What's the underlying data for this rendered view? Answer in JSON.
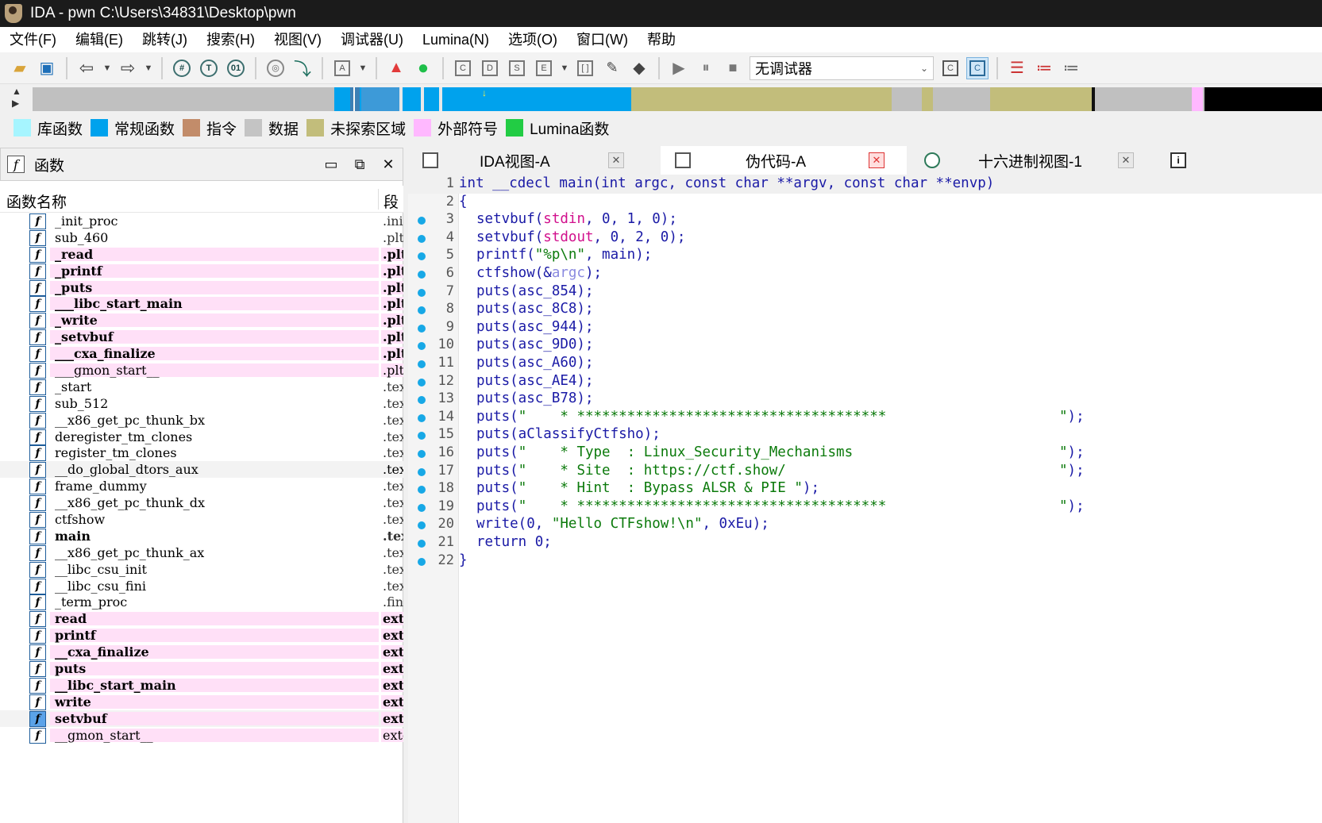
{
  "window": {
    "title": "IDA - pwn C:\\Users\\34831\\Desktop\\pwn"
  },
  "menu": [
    "文件(F)",
    "编辑(E)",
    "跳转(J)",
    "搜索(H)",
    "视图(V)",
    "调试器(U)",
    "Lumina(N)",
    "选项(O)",
    "窗口(W)",
    "帮助"
  ],
  "toolbar": {
    "debugger_select": "无调试器"
  },
  "legend": [
    {
      "label": "库函数",
      "color": "#a6f5ff"
    },
    {
      "label": "常规函数",
      "color": "#00a2ed"
    },
    {
      "label": "指令",
      "color": "#c28c6a"
    },
    {
      "label": "数据",
      "color": "#c4c4c4"
    },
    {
      "label": "未探索区域",
      "color": "#c2bd7b"
    },
    {
      "label": "外部符号",
      "color": "#ffb8ff"
    },
    {
      "label": "Lumina函数",
      "color": "#22cc44"
    }
  ],
  "functions_panel": {
    "title": "函数",
    "col_name": "函数名称",
    "col_segment": "段",
    "items": [
      {
        "name": "_init_proc",
        "segment": ".init",
        "style": "normal"
      },
      {
        "name": "sub_460",
        "segment": ".plt",
        "style": "normal"
      },
      {
        "name": "_read",
        "segment": ".plt",
        "style": "lib"
      },
      {
        "name": "_printf",
        "segment": ".plt",
        "style": "lib"
      },
      {
        "name": "_puts",
        "segment": ".plt",
        "style": "lib"
      },
      {
        "name": "___libc_start_main",
        "segment": ".plt",
        "style": "lib"
      },
      {
        "name": "_write",
        "segment": ".plt",
        "style": "lib"
      },
      {
        "name": "_setvbuf",
        "segment": ".plt",
        "style": "lib"
      },
      {
        "name": "___cxa_finalize",
        "segment": ".plt",
        "style": "lib"
      },
      {
        "name": "___gmon_start__",
        "segment": ".plt",
        "style": "libthin"
      },
      {
        "name": "_start",
        "segment": ".text",
        "style": "normal"
      },
      {
        "name": "sub_512",
        "segment": ".text",
        "style": "normal"
      },
      {
        "name": "__x86_get_pc_thunk_bx",
        "segment": ".text",
        "style": "normal"
      },
      {
        "name": "deregister_tm_clones",
        "segment": ".text",
        "style": "normal"
      },
      {
        "name": "register_tm_clones",
        "segment": ".text",
        "style": "normal"
      },
      {
        "name": "__do_global_dtors_aux",
        "segment": ".text",
        "style": "hl"
      },
      {
        "name": "frame_dummy",
        "segment": ".text",
        "style": "normal"
      },
      {
        "name": "__x86_get_pc_thunk_dx",
        "segment": ".text",
        "style": "normal"
      },
      {
        "name": "ctfshow",
        "segment": ".text",
        "style": "normal"
      },
      {
        "name": "main",
        "segment": ".text",
        "style": "bold"
      },
      {
        "name": "__x86_get_pc_thunk_ax",
        "segment": ".text",
        "style": "normal"
      },
      {
        "name": "__libc_csu_init",
        "segment": ".text",
        "style": "normal"
      },
      {
        "name": "__libc_csu_fini",
        "segment": ".text",
        "style": "normal"
      },
      {
        "name": "_term_proc",
        "segment": ".fini",
        "style": "normal"
      },
      {
        "name": "read",
        "segment": "extern",
        "style": "lib"
      },
      {
        "name": "printf",
        "segment": "extern",
        "style": "lib"
      },
      {
        "name": "__cxa_finalize",
        "segment": "extern",
        "style": "lib"
      },
      {
        "name": "puts",
        "segment": "extern",
        "style": "lib"
      },
      {
        "name": "__libc_start_main",
        "segment": "extern",
        "style": "lib"
      },
      {
        "name": "write",
        "segment": "extern",
        "style": "lib"
      },
      {
        "name": "setvbuf",
        "segment": "extern",
        "style": "libsel"
      },
      {
        "name": "__gmon_start__",
        "segment": "extern",
        "style": "libthin"
      }
    ]
  },
  "tabs": [
    {
      "label": "IDA视图-A",
      "active": false
    },
    {
      "label": "伪代码-A",
      "active": true
    },
    {
      "label": "十六进制视图-1",
      "active": false
    }
  ],
  "pseudocode": [
    {
      "n": "1",
      "dot": false,
      "parts": [
        [
          "sig",
          "int __cdecl main(int argc, const char **argv, const char **envp)"
        ]
      ]
    },
    {
      "n": "2",
      "dot": false,
      "parts": [
        [
          "kw",
          "{"
        ]
      ]
    },
    {
      "n": "3",
      "dot": true,
      "ind": true,
      "parts": [
        [
          "kw",
          "setvbuf("
        ],
        [
          "glob",
          "stdin"
        ],
        [
          "kw",
          ", 0, 1, 0);"
        ]
      ]
    },
    {
      "n": "4",
      "dot": true,
      "ind": true,
      "parts": [
        [
          "kw",
          "setvbuf("
        ],
        [
          "glob",
          "stdout"
        ],
        [
          "kw",
          ", 0, 2, 0);"
        ]
      ]
    },
    {
      "n": "5",
      "dot": true,
      "ind": true,
      "parts": [
        [
          "kw",
          "printf("
        ],
        [
          "str",
          "\"%p\\n\""
        ],
        [
          "kw",
          ", main);"
        ]
      ]
    },
    {
      "n": "6",
      "dot": true,
      "ind": true,
      "parts": [
        [
          "kw",
          "ctfshow(&"
        ],
        [
          "argc",
          "argc"
        ],
        [
          "kw",
          ");"
        ]
      ]
    },
    {
      "n": "7",
      "dot": true,
      "ind": true,
      "parts": [
        [
          "kw",
          "puts(asc_854);"
        ]
      ]
    },
    {
      "n": "8",
      "dot": true,
      "ind": true,
      "parts": [
        [
          "kw",
          "puts(asc_8C8);"
        ]
      ]
    },
    {
      "n": "9",
      "dot": true,
      "ind": true,
      "parts": [
        [
          "kw",
          "puts(asc_944);"
        ]
      ]
    },
    {
      "n": "10",
      "dot": true,
      "ind": true,
      "parts": [
        [
          "kw",
          "puts(asc_9D0);"
        ]
      ]
    },
    {
      "n": "11",
      "dot": true,
      "ind": true,
      "parts": [
        [
          "kw",
          "puts(asc_A60);"
        ]
      ]
    },
    {
      "n": "12",
      "dot": true,
      "ind": true,
      "parts": [
        [
          "kw",
          "puts(asc_AE4);"
        ]
      ]
    },
    {
      "n": "13",
      "dot": true,
      "ind": true,
      "parts": [
        [
          "kw",
          "puts(asc_B78);"
        ]
      ]
    },
    {
      "n": "14",
      "dot": true,
      "ind": true,
      "parts": [
        [
          "kw",
          "puts("
        ],
        [
          "str",
          "\"    * *************************************"
        ]
      ],
      "tail": "\");"
    },
    {
      "n": "15",
      "dot": true,
      "ind": true,
      "parts": [
        [
          "kw",
          "puts(aClassifyCtfsho);"
        ]
      ]
    },
    {
      "n": "16",
      "dot": true,
      "ind": true,
      "parts": [
        [
          "kw",
          "puts("
        ],
        [
          "str",
          "\"    * Type  : Linux_Security_Mechanisms"
        ]
      ],
      "tail": "\");"
    },
    {
      "n": "17",
      "dot": true,
      "ind": true,
      "parts": [
        [
          "kw",
          "puts("
        ],
        [
          "str",
          "\"    * Site  : https://ctf.show/"
        ]
      ],
      "tail": "\");"
    },
    {
      "n": "18",
      "dot": true,
      "ind": true,
      "parts": [
        [
          "kw",
          "puts("
        ],
        [
          "str",
          "\"    * Hint  : Bypass ALSR & PIE \""
        ],
        [
          "kw",
          ");"
        ]
      ]
    },
    {
      "n": "19",
      "dot": true,
      "ind": true,
      "parts": [
        [
          "kw",
          "puts("
        ],
        [
          "str",
          "\"    * *************************************"
        ]
      ],
      "tail": "\");"
    },
    {
      "n": "20",
      "dot": true,
      "ind": true,
      "parts": [
        [
          "kw",
          "write(0, "
        ],
        [
          "str",
          "\"Hello CTFshow!\\n\""
        ],
        [
          "kw",
          ", 0xEu);"
        ]
      ]
    },
    {
      "n": "21",
      "dot": true,
      "ind": true,
      "parts": [
        [
          "kw",
          "return 0;"
        ]
      ]
    },
    {
      "n": "22",
      "dot": true,
      "parts": [
        [
          "kw",
          "}"
        ]
      ]
    }
  ]
}
